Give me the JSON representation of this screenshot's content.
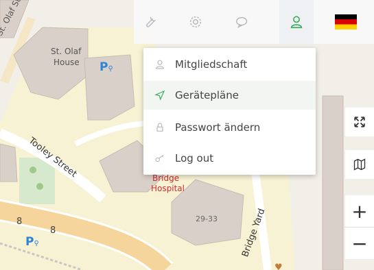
{
  "map": {
    "labels": {
      "st_olaf_stairs": "St. Olaf Stairs",
      "st_olaf_house_1": "St. Olaf",
      "st_olaf_house_2": "House",
      "tooley_street": "Tooley Street",
      "bridge": "Bridge",
      "hospital": "Hospital",
      "number_29_33": "29-33",
      "bridge_yard": "Bridge Yard",
      "parking_1": "P",
      "parking_2": "P"
    }
  },
  "topbar": {
    "icons": [
      "wrench-icon",
      "gear-icon",
      "chat-icon",
      "user-icon",
      "flag-de-icon"
    ]
  },
  "user_menu": {
    "items": [
      {
        "label": "Mitgliedschaft",
        "icon": "user-icon"
      },
      {
        "label": "Gerätepläne",
        "icon": "paper-plane-icon"
      },
      {
        "label": "Passwort ändern",
        "icon": "lock-icon"
      },
      {
        "label": "Log out",
        "icon": "key-icon"
      }
    ],
    "selected_index": 1
  },
  "map_controls": {
    "fullscreen_icon": "fullscreen-icon",
    "layers_icon": "map-icon",
    "zoom_in": "+",
    "zoom_out": "−"
  },
  "colors": {
    "accent": "#3cae5c",
    "street": "#f5d59b",
    "building": "#d9d0c9",
    "hospital_text": "#d12c2c",
    "parking_blue": "#2f84d6"
  }
}
